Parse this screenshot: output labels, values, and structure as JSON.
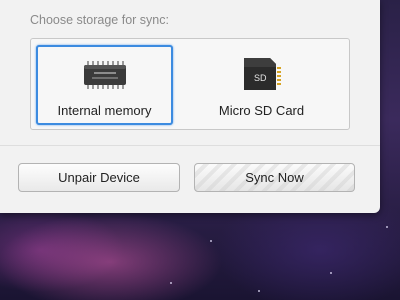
{
  "storage": {
    "prompt": "Choose storage for sync:",
    "options": [
      {
        "label": "Internal memory",
        "icon": "memory-chip-icon",
        "selected": true
      },
      {
        "label": "Micro SD Card",
        "icon": "sd-card-icon",
        "selected": false
      }
    ],
    "sd_icon_text": "SD",
    "accent_color": "#3c8be0"
  },
  "actions": {
    "unpair_label": "Unpair Device",
    "sync_label": "Sync Now"
  }
}
